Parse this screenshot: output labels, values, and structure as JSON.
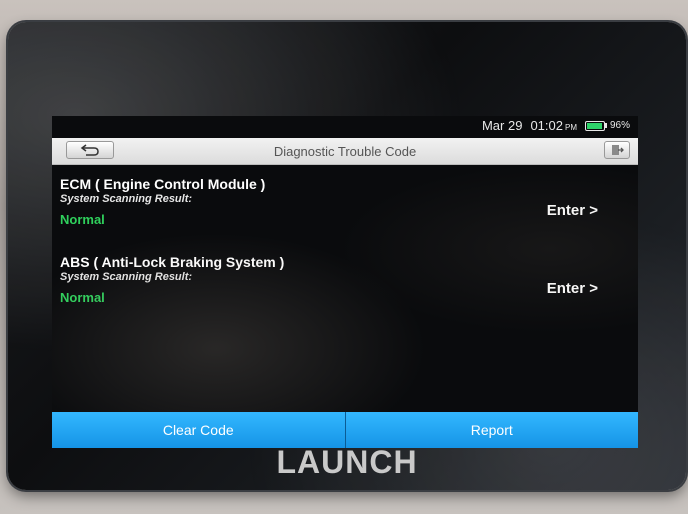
{
  "status": {
    "date": "Mar 29",
    "time": "01:02",
    "ampm": "PM",
    "battery": "96%",
    "battery_level": 0.96
  },
  "header": {
    "title": "Diagnostic Trouble Code"
  },
  "icons": {
    "back": "back-arrow-icon",
    "exit": "exit-door-icon",
    "battery": "battery-icon"
  },
  "systems": [
    {
      "name": "ECM ( Engine Control Module )",
      "result_label": "System Scanning Result:",
      "result": "Normal",
      "action": "Enter >"
    },
    {
      "name": "ABS ( Anti-Lock Braking System )",
      "result_label": "System Scanning Result:",
      "result": "Normal",
      "action": "Enter >"
    }
  ],
  "footer": {
    "clear_label": "Clear Code",
    "report_label": "Report"
  },
  "device": {
    "brand": "LAUNCH"
  },
  "colors": {
    "accent": "#1ea3f0",
    "status_normal": "#2fd05c"
  }
}
